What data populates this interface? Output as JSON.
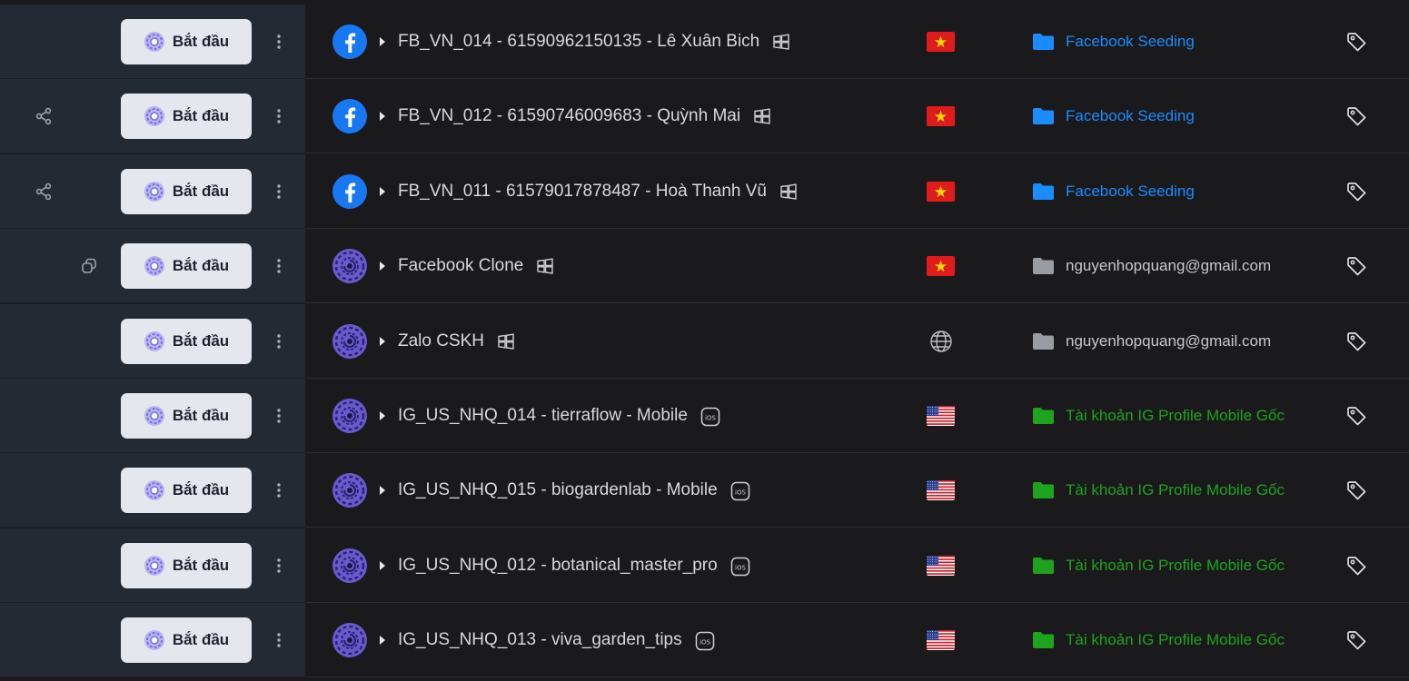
{
  "rows": [
    {
      "name": "FB_VN_014 - 61590962150135 - Lê Xuân Bich",
      "button": "Bắt đầu",
      "avatar": "facebook-icon",
      "os": "windows-icon",
      "region": "vietnam-flag-icon",
      "folder": "Facebook Seeding",
      "folder_color": "#1a8cff",
      "left_icon": "none"
    },
    {
      "name": "FB_VN_012 - 61590746009683 - Quỳnh Mai",
      "button": "Bắt đầu",
      "avatar": "facebook-icon",
      "os": "windows-icon",
      "region": "vietnam-flag-icon",
      "folder": "Facebook Seeding",
      "folder_color": "#1a8cff",
      "left_icon": "share-icon"
    },
    {
      "name": "FB_VN_011 - 61579017878487 - Hoà Thanh Vũ",
      "button": "Bắt đầu",
      "avatar": "facebook-icon",
      "os": "windows-icon",
      "region": "vietnam-flag-icon",
      "folder": "Facebook Seeding",
      "folder_color": "#1a8cff",
      "left_icon": "share-icon"
    },
    {
      "name": "Facebook Clone",
      "button": "Bắt đầu",
      "avatar": "profile-logo-icon",
      "os": "windows-icon",
      "region": "vietnam-flag-icon",
      "folder": "nguyenhopquang@gmail.com",
      "folder_color": "#9a9ca3",
      "left_icon": "clone-icon"
    },
    {
      "name": "Zalo CSKH",
      "button": "Bắt đầu",
      "avatar": "profile-logo-icon",
      "os": "windows-icon",
      "region": "globe-icon",
      "folder": "nguyenhopquang@gmail.com",
      "folder_color": "#9a9ca3",
      "left_icon": "none"
    },
    {
      "name": "IG_US_NHQ_014 - tierraflow - Mobile",
      "button": "Bắt đầu",
      "avatar": "profile-logo-icon",
      "os": "ios-icon",
      "region": "usa-flag-icon",
      "folder": "Tài khoản IG Profile Mobile Gốc",
      "folder_color": "#1ea31e",
      "left_icon": "none"
    },
    {
      "name": "IG_US_NHQ_015 - biogardenlab - Mobile",
      "button": "Bắt đầu",
      "avatar": "profile-logo-icon",
      "os": "ios-icon",
      "region": "usa-flag-icon",
      "folder": "Tài khoản IG Profile Mobile Gốc",
      "folder_color": "#1ea31e",
      "left_icon": "none"
    },
    {
      "name": "IG_US_NHQ_012 - botanical_master_pro",
      "button": "Bắt đầu",
      "avatar": "profile-logo-icon",
      "os": "ios-icon",
      "region": "usa-flag-icon",
      "folder": "Tài khoản IG Profile Mobile Gốc",
      "folder_color": "#1ea31e",
      "left_icon": "none"
    },
    {
      "name": "IG_US_NHQ_013 - viva_garden_tips",
      "button": "Bắt đầu",
      "avatar": "profile-logo-icon",
      "os": "ios-icon",
      "region": "usa-flag-icon",
      "folder": "Tài khoản IG Profile Mobile Gốc",
      "folder_color": "#1ea31e",
      "left_icon": "none"
    }
  ]
}
